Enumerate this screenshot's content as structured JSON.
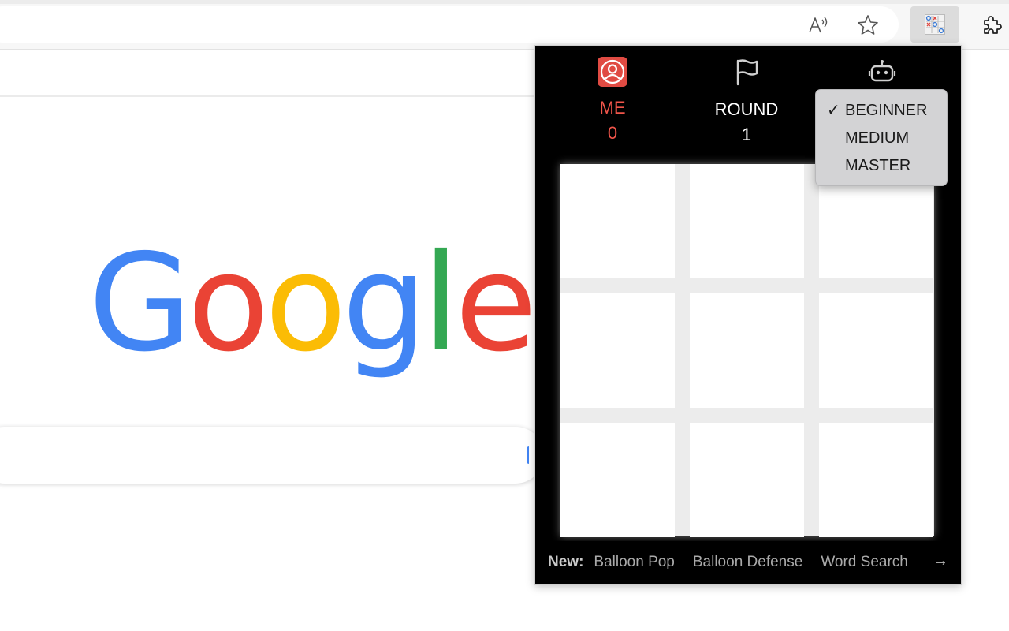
{
  "browser": {
    "icons": {
      "read_aloud": "read-aloud-icon",
      "favorite": "star-icon",
      "extension": "tic-tac-toe-extension-icon",
      "extensions_menu": "puzzle-icon"
    }
  },
  "google": {
    "logo_letters": [
      {
        "char": "G",
        "color": "#4285f4"
      },
      {
        "char": "o",
        "color": "#ea4335"
      },
      {
        "char": "o",
        "color": "#fbbc05"
      },
      {
        "char": "g",
        "color": "#4285f4"
      },
      {
        "char": "l",
        "color": "#34a853"
      },
      {
        "char": "e",
        "color": "#ea4335"
      }
    ]
  },
  "popup": {
    "me": {
      "label": "ME",
      "value": "0",
      "icon": "user-circle-icon"
    },
    "round": {
      "label": "ROUND",
      "value": "1",
      "icon": "flag-icon"
    },
    "bot": {
      "icon": "robot-icon"
    },
    "difficulty": {
      "options": [
        {
          "label": "BEGINNER",
          "checked": true
        },
        {
          "label": "MEDIUM",
          "checked": false
        },
        {
          "label": "MASTER",
          "checked": false
        }
      ],
      "check_mark": "✓"
    },
    "board": {
      "cells": [
        "",
        "",
        "",
        "",
        "",
        "",
        "",
        "",
        ""
      ]
    },
    "footer": {
      "new_label": "New:",
      "links": [
        "Balloon Pop",
        "Balloon Defense",
        "Word Search"
      ],
      "arrow": "→"
    }
  },
  "colors": {
    "accent_red": "#f0554a",
    "popup_bg": "#000000",
    "board_lines": "#ececec"
  }
}
